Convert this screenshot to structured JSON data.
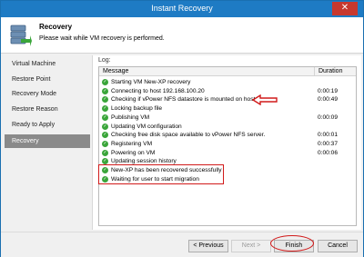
{
  "window": {
    "title": "Instant Recovery",
    "close_glyph": "✕"
  },
  "header": {
    "title": "Recovery",
    "subtitle": "Please wait while VM recovery is performed.",
    "icon": "server-restore-icon"
  },
  "sidebar": {
    "items": [
      {
        "label": "Virtual Machine",
        "active": false
      },
      {
        "label": "Restore Point",
        "active": false
      },
      {
        "label": "Recovery Mode",
        "active": false
      },
      {
        "label": "Restore Reason",
        "active": false
      },
      {
        "label": "Ready to Apply",
        "active": false
      },
      {
        "label": "Recovery",
        "active": true
      }
    ]
  },
  "log": {
    "label": "Log:",
    "columns": {
      "message": "Message",
      "duration": "Duration"
    },
    "rows": [
      {
        "message": "Starting VM New-XP recovery",
        "duration": ""
      },
      {
        "message": "Connecting to host 192.168.100.20",
        "duration": "0:00:19"
      },
      {
        "message": "Checking if vPower NFS datastore is mounted on host",
        "duration": "0:00:49"
      },
      {
        "message": "Locking backup file",
        "duration": ""
      },
      {
        "message": "Publishing VM",
        "duration": "0:00:09"
      },
      {
        "message": "Updating VM configuration",
        "duration": ""
      },
      {
        "message": "Checking free disk space available to vPower NFS server.",
        "duration": "0:00:01"
      },
      {
        "message": "Registering VM",
        "duration": "0:00:37"
      },
      {
        "message": "Powering on VM",
        "duration": "0:00:06"
      },
      {
        "message": "Updating session history",
        "duration": ""
      },
      {
        "message": "New-XP has been recovered successfully",
        "duration": ""
      },
      {
        "message": "Waiting for user to start migration",
        "duration": ""
      }
    ],
    "status_color": "#3aa53a"
  },
  "footer": {
    "previous_label": "< Previous",
    "next_label": "Next >",
    "finish_label": "Finish",
    "cancel_label": "Cancel"
  },
  "colors": {
    "titlebar": "#1e7bc4",
    "annotation": "#d11a1a",
    "active_step": "#8a8a8a"
  }
}
